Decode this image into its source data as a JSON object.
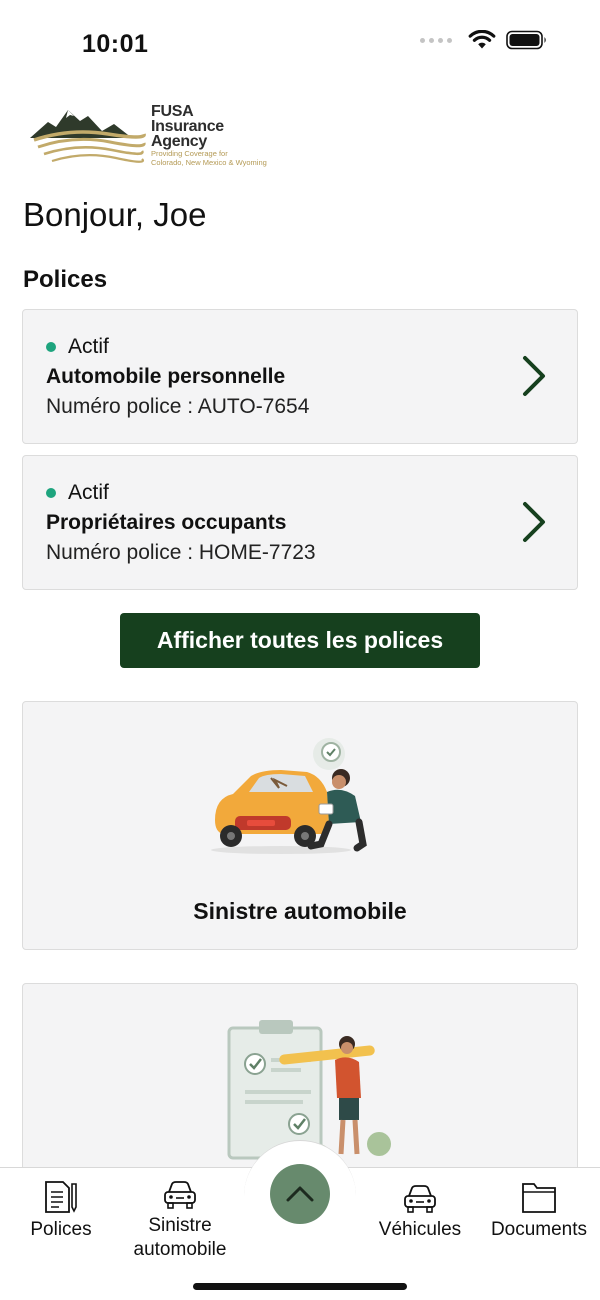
{
  "status_bar": {
    "time": "10:01"
  },
  "brand": {
    "name_lines": [
      "FUSA",
      "Insurance",
      "Agency"
    ],
    "tagline_lines": [
      "Providing Coverage for",
      "Colorado, New Mexico & Wyoming"
    ],
    "colors": {
      "mountain": "#2f3a2b",
      "wave": "#c2aa6a"
    }
  },
  "greeting": "Bonjour, Joe",
  "policies_title": "Polices",
  "policies": [
    {
      "status": "Actif",
      "name": "Automobile personnelle",
      "number": "Numéro police : AUTO-7654"
    },
    {
      "status": "Actif",
      "name": "Propriétaires occupants",
      "number": "Numéro police : HOME-7723"
    }
  ],
  "view_all_button": "Afficher toutes les polices",
  "features": [
    {
      "label": "Sinistre automobile",
      "illustration": "car-damage-illustration"
    },
    {
      "label": "",
      "illustration": "checklist-illustration"
    }
  ],
  "tab_bar": {
    "items": [
      {
        "label": "Polices",
        "icon": "document-pen-icon"
      },
      {
        "label": "Sinistre automobile",
        "icon": "car-icon"
      },
      {
        "label": "Véhicules",
        "icon": "car-icon"
      },
      {
        "label": "Documents",
        "icon": "folder-icon"
      }
    ],
    "fab_icon": "chevron-up-icon"
  },
  "colors": {
    "primary": "#16401e",
    "status_active": "#1ea47e",
    "card_bg": "#f4f4f5",
    "fab": "#678a6d"
  }
}
